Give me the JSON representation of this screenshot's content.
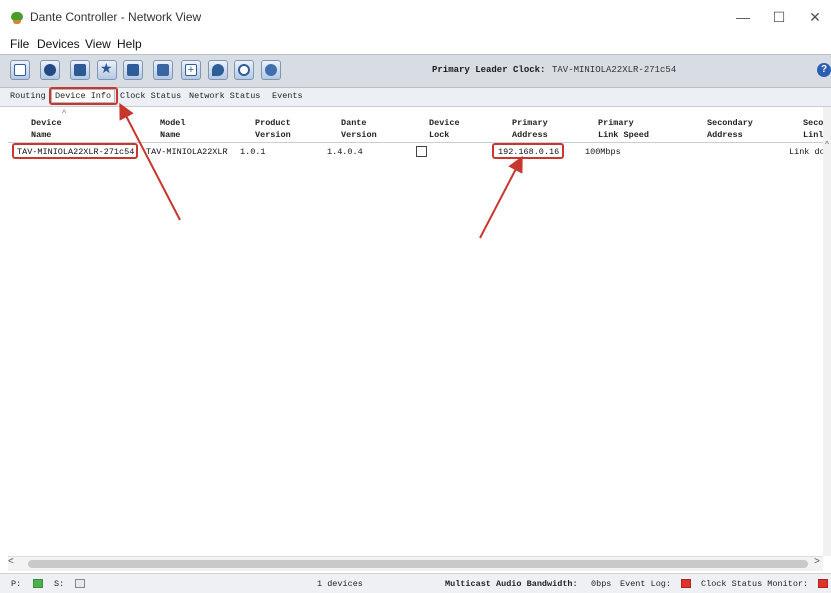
{
  "window": {
    "title": "Dante Controller - Network View",
    "minimize": "—",
    "maximize": "☐",
    "close": "✕"
  },
  "menu": [
    "File",
    "Devices",
    "View",
    "Help"
  ],
  "toolbar": {
    "icons": [
      "network-view-icon",
      "refresh-icon",
      "folder-icon",
      "favorite-star-icon",
      "device-tree-icon",
      "device-view-icon",
      "add-icon",
      "clock-droplet-icon",
      "status-circle-icon",
      "network-globe-icon"
    ],
    "leader_label": "Primary Leader Clock:",
    "leader_value": "TAV-MINIOLA22XLR-271c54",
    "help": "?"
  },
  "tabs": [
    "Routing",
    "Device Info",
    "Clock Status",
    "Network Status",
    "Events"
  ],
  "active_tab": "Device Info",
  "table": {
    "columns": [
      {
        "line1": "Device",
        "line2": "Name"
      },
      {
        "line1": "Model",
        "line2": "Name"
      },
      {
        "line1": "Product",
        "line2": "Version"
      },
      {
        "line1": "Dante",
        "line2": "Version"
      },
      {
        "line1": "Device",
        "line2": "Lock"
      },
      {
        "line1": "Primary",
        "line2": "Address"
      },
      {
        "line1": "Primary",
        "line2": "Link Speed"
      },
      {
        "line1": "Secondary",
        "line2": "Address"
      },
      {
        "line1": "Seco",
        "line2": "Linl"
      }
    ],
    "sort_indicator": "^",
    "rows": [
      {
        "device_name": "TAV-MINIOLA22XLR-271c54",
        "model_name": "TAV-MINIOLA22XLR",
        "product_version": "1.0.1",
        "dante_version": "1.4.0.4",
        "device_lock": false,
        "primary_address": "192.168.0.16",
        "primary_link_speed": "100Mbps",
        "secondary_address": "",
        "secondary_link": "Link do"
      }
    ]
  },
  "scroll": {
    "left": "<",
    "right": ">",
    "up": "^"
  },
  "status": {
    "p_label": "P:",
    "s_label": "S:",
    "devices": "1 devices",
    "bandwidth_label": "Multicast Audio Bandwidth:",
    "bandwidth_value": "0bps",
    "event_log": "Event Log:",
    "clock_monitor": "Clock Status Monitor:"
  },
  "colors": {
    "annotation_red": "#c8372d",
    "status_green": "#4caf50",
    "status_red": "#e0312b"
  }
}
